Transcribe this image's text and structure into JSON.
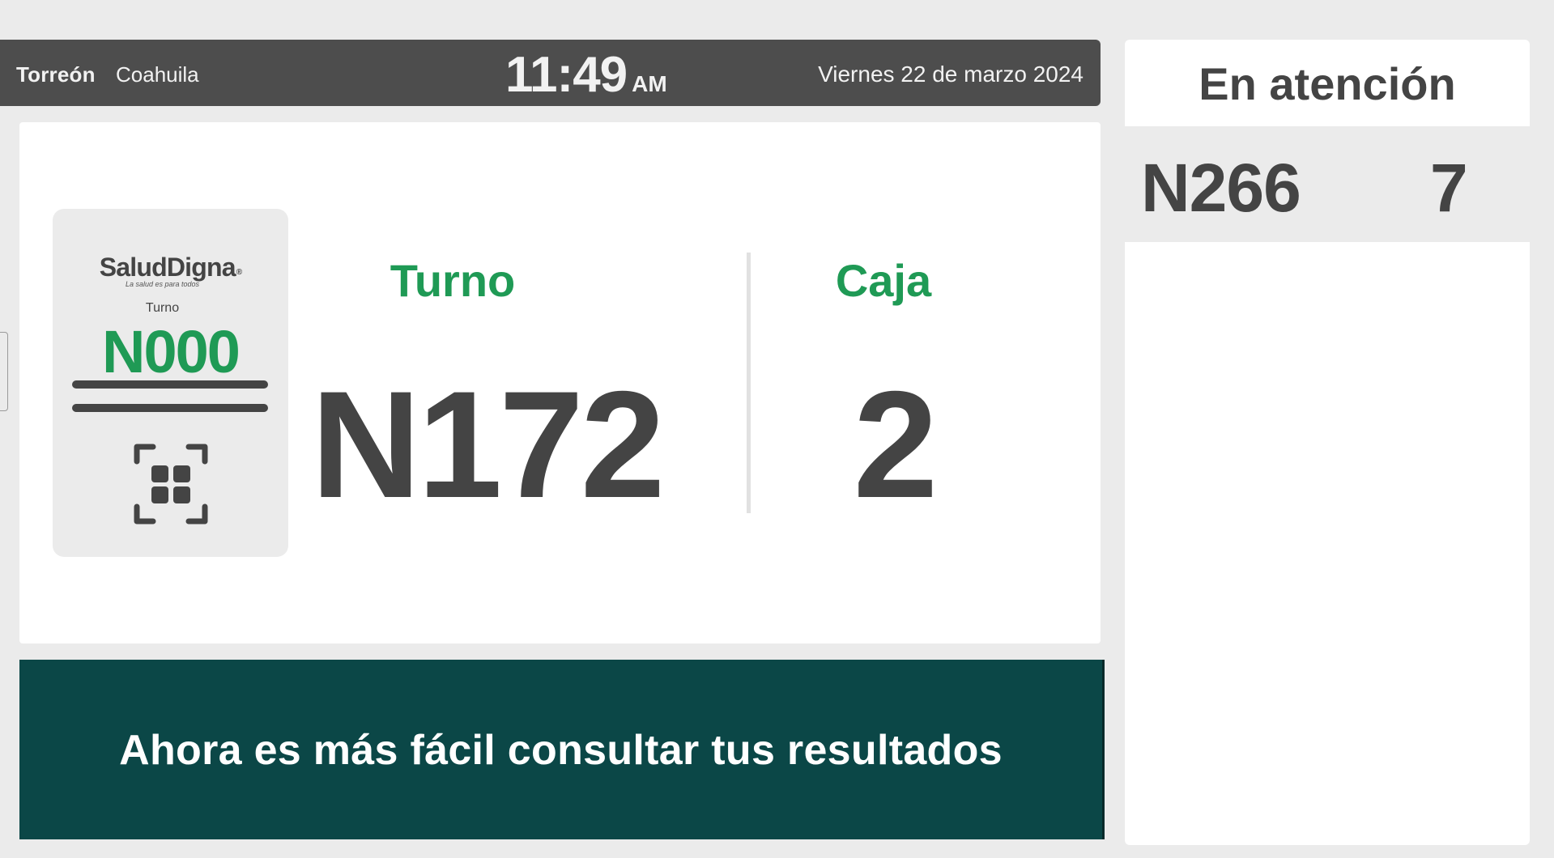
{
  "header": {
    "city": "Torreón",
    "state": "Coahuila",
    "time": "11:49",
    "ampm": "AM",
    "date": "Viernes 22 de marzo 2024"
  },
  "ticket_illustration": {
    "brand": "SaludDigna",
    "brand_mark": "®",
    "tagline": "La salud es para todos",
    "label": "Turno",
    "number": "N000",
    "icon": "qr-scan-icon"
  },
  "current_call": {
    "turno_label": "Turno",
    "turno_value": "N172",
    "caja_label": "Caja",
    "caja_value": "2"
  },
  "banner": {
    "text": "Ahora es más fácil consultar tus resultados"
  },
  "sidebar": {
    "title": "En atención",
    "rows": [
      {
        "turno": "N266",
        "caja": "7"
      }
    ]
  },
  "colors": {
    "accent_green": "#1f9a55",
    "topbar": "#4d4d4d",
    "banner": "#0b4747",
    "text_dark": "#444444"
  }
}
